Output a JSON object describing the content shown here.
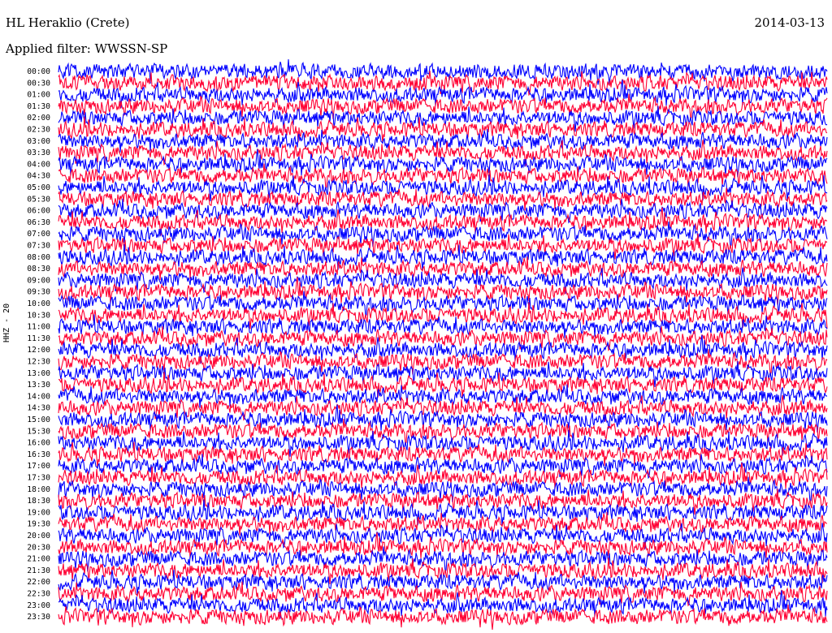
{
  "header": {
    "station": "HL Heraklio (Crete)",
    "date": "2014-03-13",
    "filter": "Applied filter: WWSSN-SP"
  },
  "channel_label": "HHZ - 20",
  "chart_data": {
    "type": "line",
    "title": "HL Heraklio (Crete)",
    "subtitle": "Applied filter: WWSSN-SP",
    "date": "2014-03-13",
    "ylabel": "HHZ - 20",
    "row_labels": [
      "00:00",
      "00:30",
      "01:00",
      "01:30",
      "02:00",
      "02:30",
      "03:00",
      "03:30",
      "04:00",
      "04:30",
      "05:00",
      "05:30",
      "06:00",
      "06:30",
      "07:00",
      "07:30",
      "08:00",
      "08:30",
      "09:00",
      "09:30",
      "10:00",
      "10:30",
      "11:00",
      "11:30",
      "12:00",
      "12:30",
      "13:00",
      "13:30",
      "14:00",
      "14:30",
      "15:00",
      "15:30",
      "16:00",
      "16:30",
      "17:00",
      "17:30",
      "18:00",
      "18:30",
      "19:00",
      "19:30",
      "20:00",
      "20:30",
      "21:00",
      "21:30",
      "22:00",
      "22:30",
      "23:00",
      "23:30"
    ],
    "row_minutes": 30,
    "series_colors": [
      "#0000ff",
      "#ff0033"
    ],
    "grid": false
  }
}
